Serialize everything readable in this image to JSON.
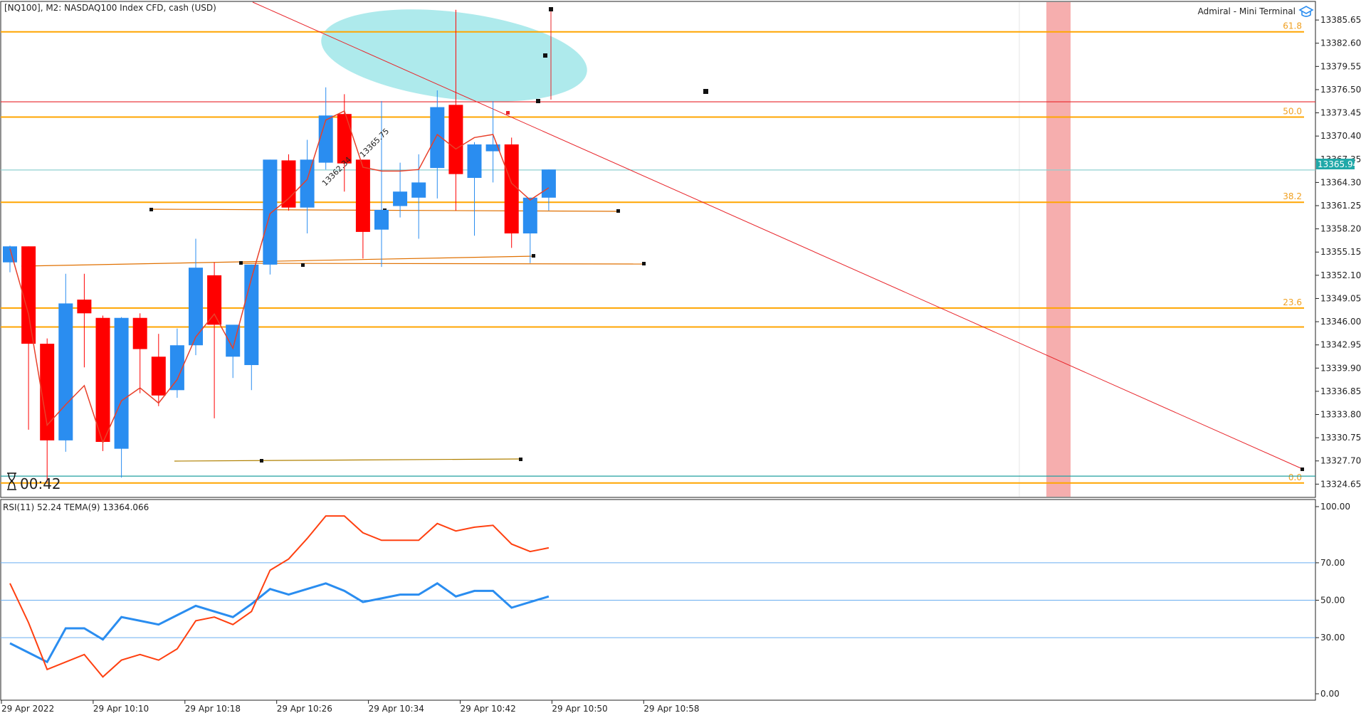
{
  "header": {
    "title": "[NQ100], M2:  NASDAQ100 Index CFD, cash (USD)",
    "terminal": "Admiral - Mini Terminal"
  },
  "timer": "00:42",
  "current_price_label": "13365.94",
  "indicator_label": "RSI(11) 52.24 TEMA(9) 13364.066",
  "annotations": [
    "13362.34",
    "13365.75"
  ],
  "colors": {
    "bull": "#2a8df0",
    "bear": "#ff0000",
    "fib": "#ffa500",
    "trend": "#e8242a",
    "ellipse": "#aeeaec",
    "rsi": "#2a8df0",
    "tema": "#ff4010",
    "session_band": "#f4a0a0",
    "current_price": "#20a8a8"
  },
  "chart_data": [
    {
      "type": "candlestick",
      "ylim": [
        13323.0,
        13388.0
      ],
      "price_ticks": [
        "13385.65",
        "13382.60",
        "13379.55",
        "13376.50",
        "13373.45",
        "13370.40",
        "13367.35",
        "13364.30",
        "13361.25",
        "13358.20",
        "13355.15",
        "13352.10",
        "13349.05",
        "13346.00",
        "13342.95",
        "13339.90",
        "13336.85",
        "13333.80",
        "13330.75",
        "13327.70",
        "13324.65"
      ],
      "time_labels": [
        "29 Apr 2022",
        "29 Apr 10:10",
        "29 Apr 10:18",
        "29 Apr 10:26",
        "29 Apr 10:34",
        "29 Apr 10:42",
        "29 Apr 10:50",
        "29 Apr 10:58"
      ],
      "candles": [
        {
          "o": 13353.8,
          "h": 13356.0,
          "l": 13352.5,
          "c": 13355.9
        },
        {
          "o": 13355.9,
          "h": 13355.9,
          "l": 13331.8,
          "c": 13343.1
        },
        {
          "o": 13343.1,
          "h": 13343.8,
          "l": 13324.9,
          "c": 13330.4
        },
        {
          "o": 13330.4,
          "h": 13352.3,
          "l": 13328.9,
          "c": 13348.4
        },
        {
          "o": 13348.9,
          "h": 13352.3,
          "l": 13340.0,
          "c": 13347.1
        },
        {
          "o": 13346.5,
          "h": 13346.8,
          "l": 13329.0,
          "c": 13330.2
        },
        {
          "o": 13329.3,
          "h": 13346.6,
          "l": 13325.5,
          "c": 13346.5
        },
        {
          "o": 13346.5,
          "h": 13347.1,
          "l": 13336.6,
          "c": 13342.4
        },
        {
          "o": 13341.4,
          "h": 13344.4,
          "l": 13334.9,
          "c": 13336.3
        },
        {
          "o": 13337.0,
          "h": 13345.1,
          "l": 13336.0,
          "c": 13342.9
        },
        {
          "o": 13342.9,
          "h": 13356.9,
          "l": 13341.6,
          "c": 13353.1
        },
        {
          "o": 13352.1,
          "h": 13353.8,
          "l": 13333.3,
          "c": 13345.6
        },
        {
          "o": 13341.4,
          "h": 13345.0,
          "l": 13338.6,
          "c": 13345.6
        },
        {
          "o": 13340.3,
          "h": 13353.5,
          "l": 13337.0,
          "c": 13353.5
        },
        {
          "o": 13353.5,
          "h": 13367.3,
          "l": 13352.2,
          "c": 13367.3
        },
        {
          "o": 13367.2,
          "h": 13368.0,
          "l": 13360.6,
          "c": 13361.0
        },
        {
          "o": 13361.0,
          "h": 13369.9,
          "l": 13357.6,
          "c": 13367.3
        },
        {
          "o": 13366.9,
          "h": 13376.8,
          "l": 13366.0,
          "c": 13373.1
        },
        {
          "o": 13373.3,
          "h": 13375.9,
          "l": 13363.1,
          "c": 13366.8
        },
        {
          "o": 13367.3,
          "h": 13367.3,
          "l": 13354.3,
          "c": 13357.8
        },
        {
          "o": 13358.1,
          "h": 13375.0,
          "l": 13353.2,
          "c": 13360.7
        },
        {
          "o": 13361.2,
          "h": 13366.9,
          "l": 13359.7,
          "c": 13363.1
        },
        {
          "o": 13362.3,
          "h": 13368.0,
          "l": 13356.9,
          "c": 13364.3
        },
        {
          "o": 13366.2,
          "h": 13376.4,
          "l": 13362.2,
          "c": 13374.2
        },
        {
          "o": 13374.5,
          "h": 13387.0,
          "l": 13360.6,
          "c": 13365.4
        },
        {
          "o": 13364.9,
          "h": 13369.6,
          "l": 13357.3,
          "c": 13369.3
        },
        {
          "o": 13368.4,
          "h": 13375.0,
          "l": 13364.3,
          "c": 13369.3
        },
        {
          "o": 13369.3,
          "h": 13370.2,
          "l": 13355.7,
          "c": 13357.6
        },
        {
          "o": 13357.6,
          "h": 13362.3,
          "l": 13353.7,
          "c": 13362.3
        },
        {
          "o": 13362.3,
          "h": 13366.0,
          "l": 13360.6,
          "c": 13366.0
        }
      ],
      "tema": [
        13355.6,
        13347.0,
        13332.4,
        13335.1,
        13337.6,
        13330.1,
        13335.6,
        13337.3,
        13335.3,
        13338.4,
        13344.0,
        13347.0,
        13342.5,
        13351.7,
        13360.2,
        13362.2,
        13364.7,
        13372.5,
        13373.7,
        13366.3,
        13365.8,
        13365.8,
        13366.0,
        13370.6,
        13368.7,
        13370.2,
        13370.6,
        13364.2,
        13362.0,
        13363.6
      ],
      "fib_levels": [
        {
          "label": "61.8",
          "price": 13384.1
        },
        {
          "label": "50.0",
          "price": 13372.9
        },
        {
          "label": "38.2",
          "price": 13361.7
        },
        {
          "label": "23.6",
          "price": 13347.8
        },
        {
          "label": "",
          "price": 13345.3
        },
        {
          "label": "0.0",
          "price": 13324.8
        }
      ],
      "horizontal_lines": [
        {
          "price": 13374.9,
          "color": "#e8242a"
        },
        {
          "price": 13365.94,
          "color": "#8fd0d0"
        },
        {
          "price": 13325.7,
          "color": "#20a0a0"
        }
      ]
    },
    {
      "type": "line",
      "ylim": [
        0,
        100
      ],
      "levels": [
        "100.00",
        "70.00",
        "50.00",
        "30.00",
        "0.00"
      ],
      "level_values": [
        100,
        70,
        50,
        30,
        0
      ],
      "series": [
        {
          "name": "RSI(11)",
          "color": "#2a8df0",
          "values": [
            27,
            22,
            17,
            35,
            35,
            29,
            41,
            39,
            37,
            42,
            47,
            44,
            41,
            48,
            56,
            53,
            56,
            59,
            55,
            49,
            51,
            53,
            53,
            59,
            52,
            55,
            55,
            46,
            49,
            52
          ]
        },
        {
          "name": "TEMA(9)",
          "color": "#ff4010",
          "values": [
            59,
            38,
            13,
            17,
            21,
            9,
            18,
            21,
            18,
            24,
            39,
            41,
            37,
            44,
            66,
            72,
            83,
            95,
            95,
            86,
            82,
            82,
            82,
            91,
            87,
            89,
            90,
            80,
            76,
            78
          ]
        }
      ]
    }
  ]
}
